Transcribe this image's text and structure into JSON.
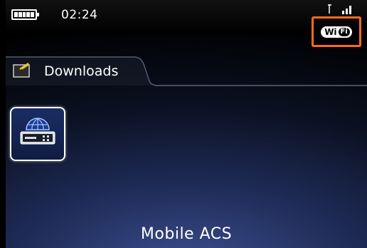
{
  "status_bar": {
    "time": "02:24",
    "battery_icon": "battery-full-icon",
    "signal_icon": "signal-strength-icon",
    "wifi_badge": {
      "left_text": "Wi",
      "right_text": "Fi",
      "highlight_color": "#ff6a1a"
    }
  },
  "folder": {
    "label": "Downloads",
    "icon": "folder-icon"
  },
  "apps": [
    {
      "label": "Mobile ACS",
      "icon": "globe-router-icon",
      "selected": true
    }
  ],
  "colors": {
    "background_glow": "#3b4f8f",
    "highlight": "#ff6a1a"
  }
}
